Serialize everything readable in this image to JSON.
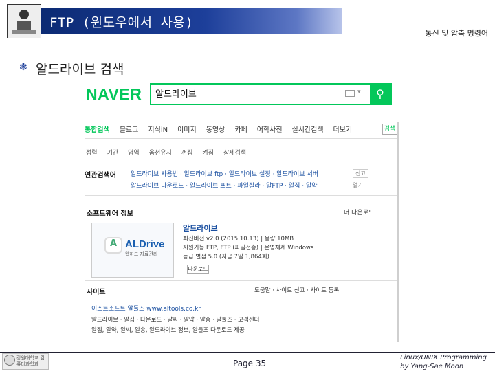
{
  "header": {
    "title": "FTP (윈도우에서 사용)",
    "course": "통신 및 압축 명령어"
  },
  "section": {
    "title": "알드라이브 검색"
  },
  "naver": {
    "logo": "NAVER",
    "search_value": "알드라이브",
    "nav_tabs": [
      "통합검색",
      "블로그",
      "지식iN",
      "이미지",
      "동영상",
      "카페",
      "어학사전",
      "실시간검색",
      "더보기"
    ],
    "search_tab_btn": "검색",
    "filters": [
      "정렬",
      "기간",
      "영역",
      "옵션유지",
      "꺼짐",
      "켜짐",
      "상세검색"
    ],
    "related": {
      "label": "연관검색어",
      "row1": "알드라이브 사용법 · 알드라이브 ftp · 알드라이브 설정 · 알드라이브 서버",
      "row2": "알드라이브 다운로드 · 알드라이브 포트 · 파일질라 · 알FTP · 알집 · 알약",
      "ctrl1": "신고",
      "ctrl2": "열기"
    },
    "software": {
      "heading": "소프트웨어 정보",
      "more": "더 다운로드",
      "thumb_name": "ALDrive",
      "thumb_caption": "웹하드 자료관리",
      "name": "알드라이브",
      "lines": [
        "최신버전 v2.0 (2015.10.13) | 용량 10MB",
        "지원기능 FTP, FTP (파일전송) | 운영체제 Windows",
        "등급 별점 5.0 (지금 7일 1,864회)"
      ],
      "download": "다운로드"
    },
    "sites": {
      "heading": "사이트",
      "links": "도움말 · 사이트 신고 · 사이트 등록",
      "title": "이스트소프트 알툴즈 www.altools.co.kr",
      "nav": "알드라이브 · 알집 · 다운로드 · 알씨 · 알약 · 알송 · 알툴즈 · 고객센터",
      "desc": "알집, 알약, 알씨, 알송, 알드라이브 정보, 알툴즈 다운로드 제공"
    }
  },
  "footer": {
    "page": "Page 35",
    "credit_line1": "Linux/UNIX Programming",
    "credit_line2": "by Yang-Sae Moon",
    "logo_text": "강원대학교 컴퓨터과학과"
  }
}
